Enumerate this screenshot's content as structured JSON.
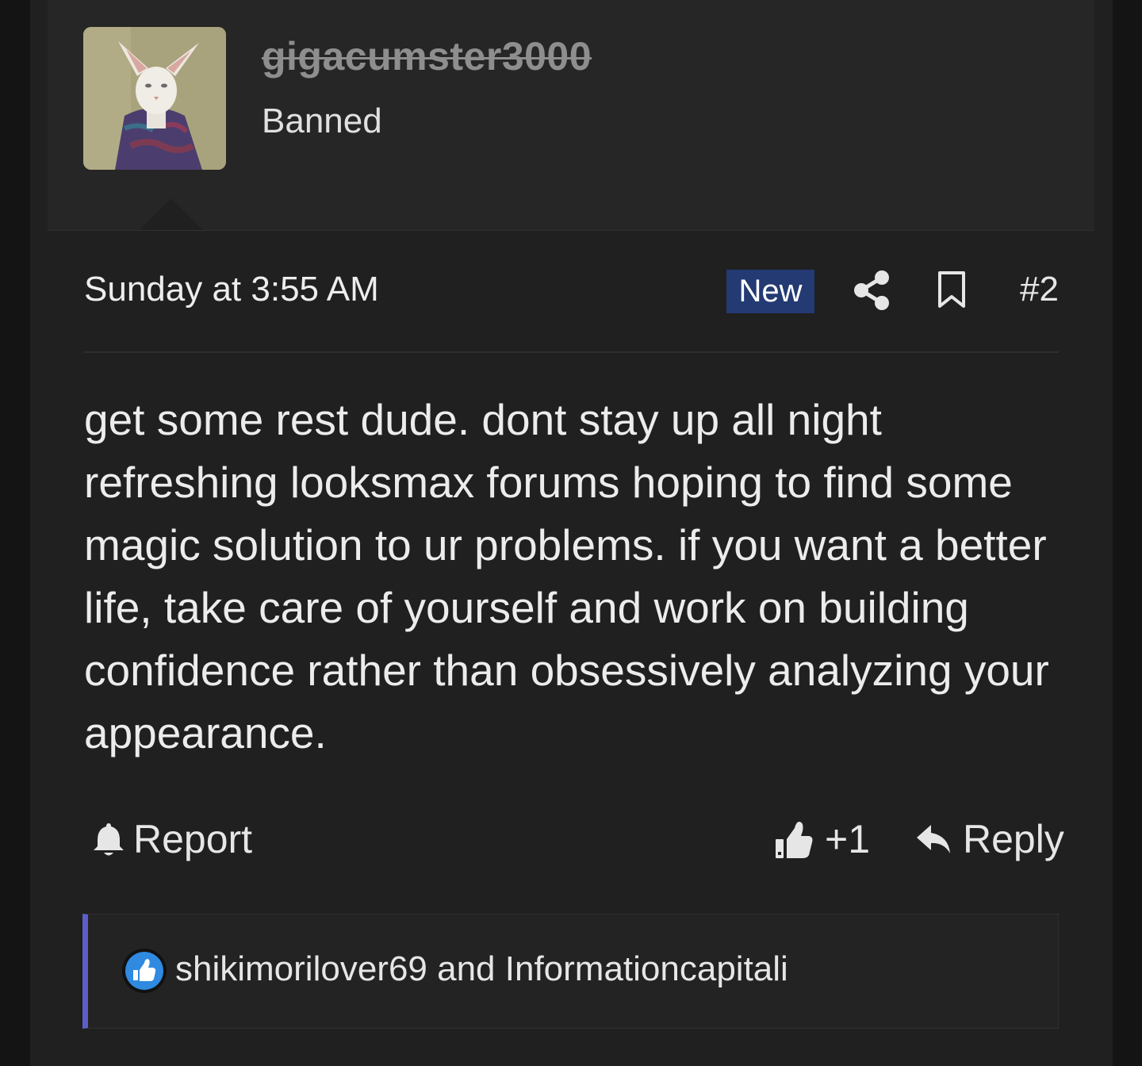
{
  "user": {
    "username": "gigacumster3000",
    "title": "Banned",
    "avatar_icon": "cat-in-sweater-avatar"
  },
  "post": {
    "date": "Sunday at 3:55 AM",
    "badge_new": "New",
    "share_icon": "share-icon",
    "bookmark_icon": "bookmark-icon",
    "number": "#2",
    "body": "get some rest dude. dont stay up all night refreshing looksmax forums hoping to find some magic solution to ur problems. if you want a better life, take care of yourself and work on building confidence rather than obsessively analyzing your appearance."
  },
  "actions": {
    "report_label": "Report",
    "report_icon": "bell-icon",
    "reaction_count": "+1",
    "reaction_icon": "thumbs-up-icon",
    "reply_label": "Reply",
    "reply_icon": "reply-arrow-icon"
  },
  "reactions": {
    "icon": "like-badge-icon",
    "users_text": "shikimorilover69 and Informationcapitali"
  },
  "colors": {
    "background": "#202020",
    "user_block": "#262626",
    "badge_new": "#233a72",
    "reaction_accent": "#5b5fc7",
    "like_badge": "#2f8ae0"
  }
}
